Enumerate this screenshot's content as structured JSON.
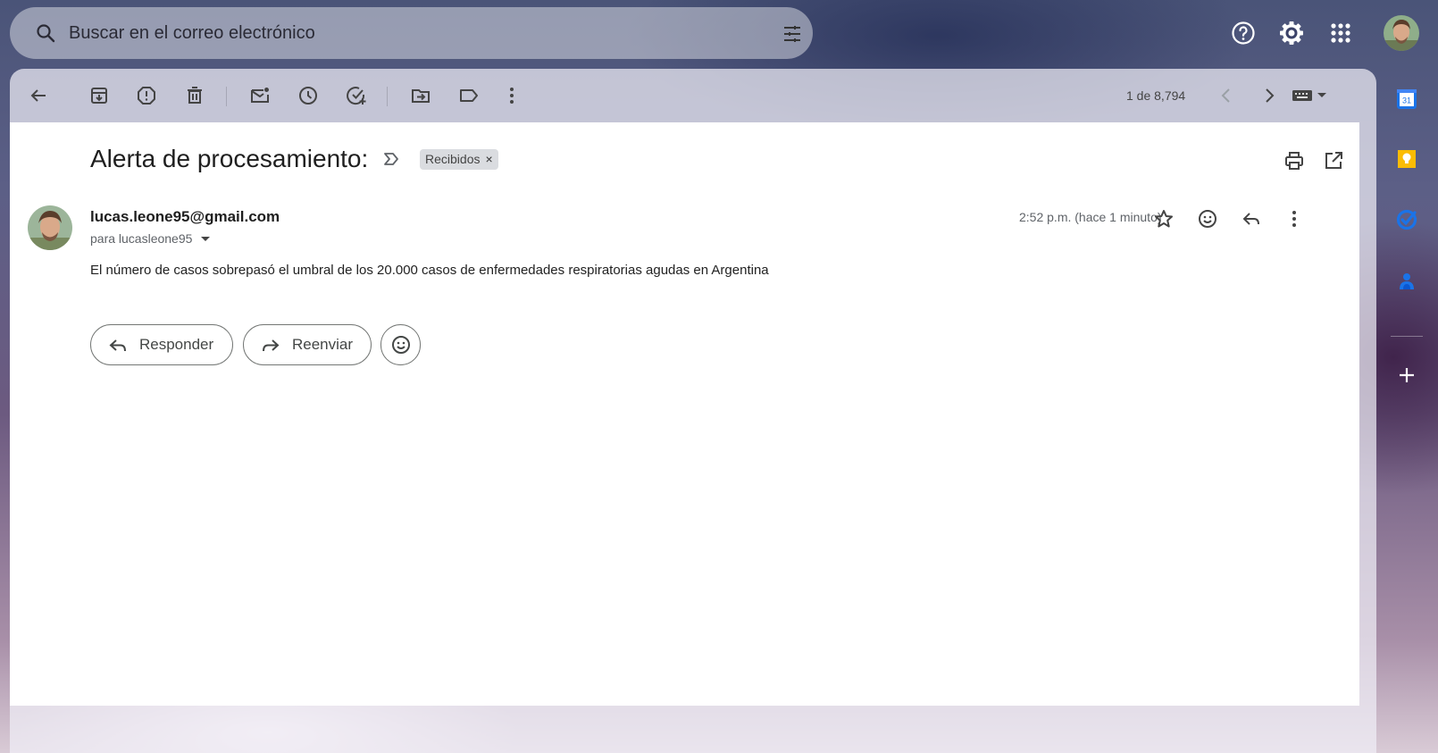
{
  "search": {
    "placeholder": "Buscar en el correo electrónico",
    "icon": "search-icon",
    "filter_icon": "tune-icon"
  },
  "header_icons": [
    "help-icon",
    "settings-icon",
    "apps-grid-icon",
    "account-avatar"
  ],
  "toolbar": {
    "left_icons": [
      "back-arrow-icon",
      "archive-icon",
      "report-spam-icon",
      "delete-icon",
      "mark-unread-icon",
      "snooze-icon",
      "add-task-icon",
      "move-to-icon",
      "label-icon",
      "more-vert-icon"
    ],
    "pager": "1 de 8,794",
    "right_icons": [
      "chevron-left-icon",
      "chevron-right-icon",
      "keyboard-icon"
    ]
  },
  "message": {
    "subject": "Alerta de procesamiento:",
    "label_chip": "Recibidos",
    "label_chip_close": "×",
    "sender": "lucas.leone95@gmail.com",
    "recipient": "para lucasleone95",
    "time": "2:52 p.m. (hace 1 minuto)",
    "body": "El número de casos sobrepasó el umbral de los 20.000 casos de enfermedades respiratorias agudas en Argentina"
  },
  "actions": {
    "reply_label": "Responder",
    "forward_label": "Reenviar"
  },
  "side_panel": {
    "apps": [
      "calendar-icon",
      "keep-icon",
      "tasks-icon",
      "contacts-icon",
      "add-icon"
    ],
    "calendar_day": "31"
  },
  "colors": {
    "calendar_blue": "#1a73e8",
    "keep_yellow": "#fbbc04",
    "tasks_blue": "#1a73e8"
  }
}
